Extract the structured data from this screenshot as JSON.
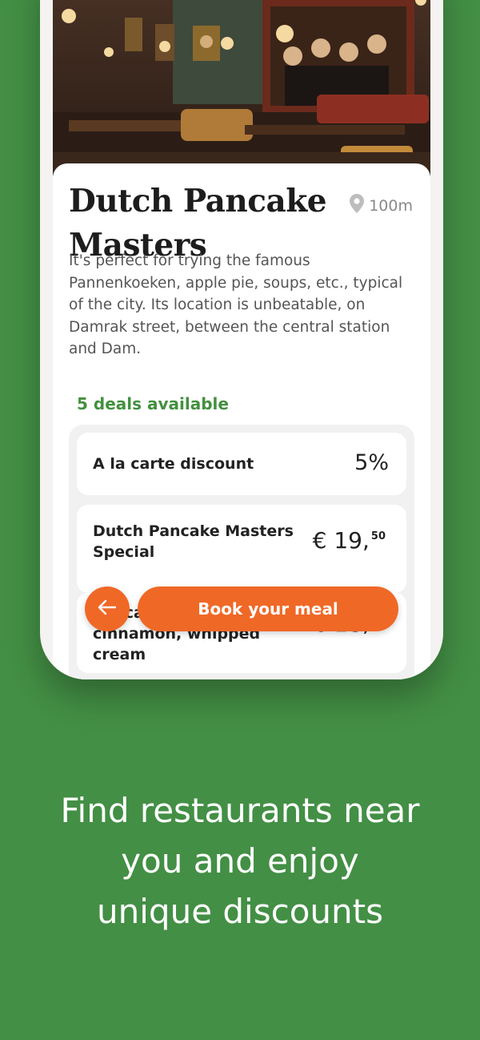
{
  "restaurant": {
    "name_line1": "Dutch Pancake",
    "name_line2": "Masters",
    "distance": "100m",
    "description": "It's perfect for trying the famous Pannenkoeken, apple pie, soups, etc., typical of the city. Its location is unbeatable, on Damrak street, between the central station and Dam."
  },
  "deals": {
    "count_label": "5 deals available",
    "items": [
      {
        "name": "A la carte discount",
        "value": "5%"
      },
      {
        "name": "Dutch Pancake Masters Special",
        "price_main": "€ 19,",
        "price_cents": "50"
      },
      {
        "name": "Pancake Apple, raisin, cinnamon, whipped cream",
        "price_main": "€ 18,",
        "price_cents": "50"
      }
    ]
  },
  "actions": {
    "book_label": "Book your meal"
  },
  "tagline": {
    "line1": "Find restaurants near",
    "line2": "you and enjoy",
    "line3": "unique discounts"
  },
  "colors": {
    "background": "#438f45",
    "accent": "#f06826",
    "deals_label": "#43903f"
  },
  "icons": [
    "location-pin-icon",
    "arrow-left-icon"
  ]
}
